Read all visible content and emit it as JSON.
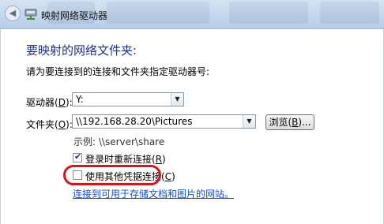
{
  "window": {
    "title": "映射网络驱动器"
  },
  "main": {
    "heading": "要映射的网络文件夹:",
    "instruction": "请为要连接到的连接和文件夹指定驱动器号:",
    "drive": {
      "label_prefix": "驱动器(",
      "label_key": "D",
      "label_suffix": "):",
      "value": "Y:"
    },
    "folder": {
      "label_prefix": "文件夹(",
      "label_key": "O",
      "label_suffix": "):",
      "value": "\\\\192.168.28.20\\Pictures"
    },
    "browse": {
      "prefix": "浏览(",
      "key": "B",
      "suffix": ")..."
    },
    "example": "示例: \\\\server\\share",
    "reconnect": {
      "prefix": "登录时重新连接(",
      "key": "R",
      "suffix": ")",
      "checked": true
    },
    "other_creds": {
      "prefix": "使用其他凭据连接(",
      "key": "C",
      "suffix": ")",
      "checked": false
    },
    "link": "连接到可用于存储文档和图片的网站。"
  },
  "colors": {
    "heading": "#1e3287",
    "link": "#1a4fc4",
    "highlight": "#cc1a1a"
  }
}
